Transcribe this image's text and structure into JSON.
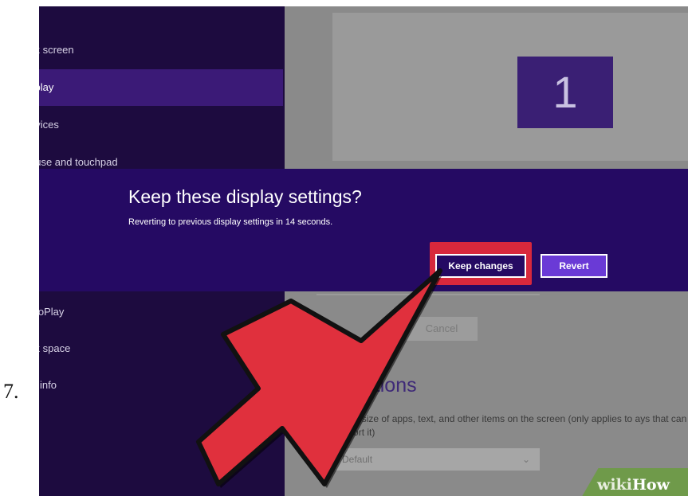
{
  "step": {
    "number": "7."
  },
  "sidebar": {
    "items": [
      {
        "label": "ck screen",
        "active": false
      },
      {
        "label": "splay",
        "active": true
      },
      {
        "label": "evices",
        "active": false
      },
      {
        "label": "ouse and touchpad",
        "active": false
      },
      {
        "label": "utoPlay",
        "active": false
      },
      {
        "label": "sk space",
        "active": false
      },
      {
        "label": "C info",
        "active": false
      }
    ]
  },
  "preview": {
    "monitor_label": "1"
  },
  "content": {
    "cancel_label": "Cancel",
    "options_heading": "options",
    "options_desc": "ge the size of apps, text, and other items on the screen (only applies to ays that can support it)",
    "scale_value": "Default"
  },
  "dialog": {
    "title": "Keep these display settings?",
    "message": "Reverting to previous display settings in 14 seconds.",
    "keep_label": "Keep changes",
    "revert_label": "Revert"
  },
  "watermark": {
    "prefix": "wiki",
    "brand": "How"
  },
  "colors": {
    "sidebar_bg": "#1d0b3f",
    "dialog_bg": "#250a63",
    "highlight": "#d8283c",
    "arrow": "#e0303d",
    "revert_bg": "#6a3ad6"
  }
}
